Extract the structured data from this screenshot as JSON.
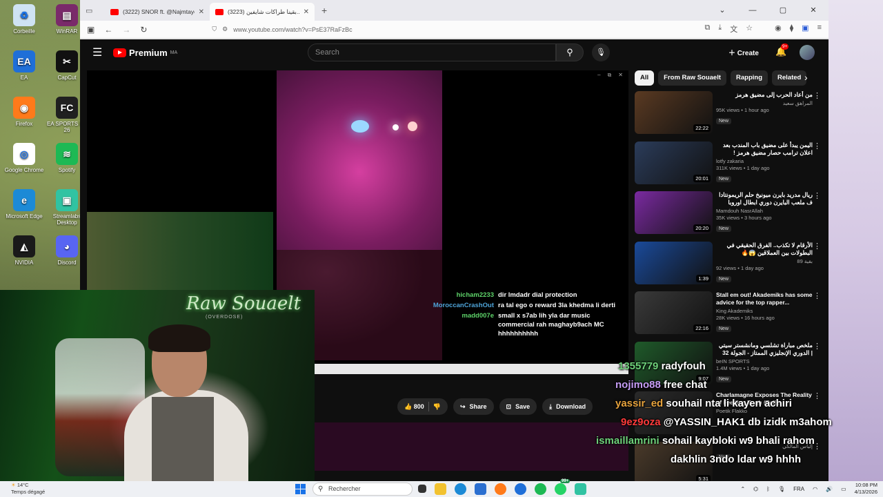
{
  "desktop": {
    "icons": [
      {
        "label": "Corbeille",
        "color": "#cfe3f3",
        "glyph": "♻"
      },
      {
        "label": "WinRAR",
        "color": "#7a2a6a",
        "glyph": "▤"
      },
      {
        "label": "EA",
        "color": "#1f6fd8",
        "glyph": "EA"
      },
      {
        "label": "CapCut",
        "color": "#111111",
        "glyph": "✂"
      },
      {
        "label": "Firefox",
        "color": "#ff7a1a",
        "glyph": "◉"
      },
      {
        "label": "EA SPORTS FC 26",
        "color": "#202020",
        "glyph": "FC"
      },
      {
        "label": "Google Chrome",
        "color": "#ffffff",
        "glyph": "◎"
      },
      {
        "label": "Spotify",
        "color": "#1db954",
        "glyph": "≋"
      },
      {
        "label": "Microsoft Edge",
        "color": "#1c8ad6",
        "glyph": "e"
      },
      {
        "label": "Streamlabs Desktop",
        "color": "#31c3a2",
        "glyph": "▣"
      },
      {
        "label": "NVIDIA",
        "color": "#1a1a1a",
        "glyph": "◭"
      },
      {
        "label": "Discord",
        "color": "#5865f2",
        "glyph": "◕"
      }
    ]
  },
  "browser": {
    "tabs": [
      {
        "title": "(3222) SNOR ft. @Najmtayer - I",
        "active": false
      },
      {
        "title": "(3223) بقينا طراكات شايفين...",
        "active": true
      }
    ],
    "url": "www.youtube.com/watch?v=PsE37RaFzBc"
  },
  "youtube": {
    "logo_text": "Premium",
    "region": "MA",
    "search_placeholder": "Search",
    "create_label": "Create",
    "notif_count": "9+",
    "actions": {
      "likes": "800",
      "share": "Share",
      "save": "Save",
      "download": "Download"
    },
    "chips": [
      "All",
      "From Raw Souaelt",
      "Rapping",
      "Related"
    ],
    "recommendations": [
      {
        "title": "من أعاد الحرب إلى مضيق هرمز",
        "channel": "المراهق سعيد",
        "meta": "95K views • 1 hour ago",
        "duration": "22:22",
        "new": "New",
        "thumb": "#5a3a22"
      },
      {
        "title": "اليمن يبدأ على مضيق باب المندب بعد اعلان ترامب حصار مضيق هرمز !",
        "channel": "lotfy zakaria",
        "meta": "311K views • 1 day ago",
        "duration": "20:01",
        "new": "New",
        "thumb": "#2b3c5a"
      },
      {
        "title": "ريال مدريد بايرن ميونيخ حلم الريمونتادا ف ملعب البايرن دوري ابطال اوروبا ارسنال",
        "channel": "Mamdouh NasrAllah",
        "meta": "35K views • 3 hours ago",
        "duration": "20:20",
        "new": "New",
        "thumb": "#7a2aa0"
      },
      {
        "title": "الأرقام لا تكذب.. الفرق الحقيقي في البطولات بين العملاقين 😱🔥",
        "channel": "بقية 89",
        "meta": "92 views • 1 day ago",
        "duration": "1:39",
        "new": "New",
        "thumb": "#1a4a9a"
      },
      {
        "title": "Stall em out! Akademiks has some advice for the top rapper...",
        "channel": "King Akademiks",
        "meta": "28K views • 16 hours ago",
        "duration": "22:16",
        "new": "New",
        "thumb": "#3a3a3a"
      },
      {
        "title": "ملخص مباراة تشلسي ومانشستر سيتي | الدوري الإنجليزي الممتاز - الجولة 32",
        "channel": "beIN SPORTS",
        "meta": "1.4M views • 1 day ago",
        "duration": "9:07",
        "new": "New",
        "thumb": "#1f5a2a"
      },
      {
        "title": "Charlamagne Exposes The Reality of Feeding Truth (Full...",
        "channel": "Poetik Flakko",
        "meta": "",
        "duration": "",
        "new": "",
        "thumb": "#2a2a2a"
      },
      {
        "title": "",
        "channel": "إلياس المالكي",
        "meta": "",
        "duration": "5:31",
        "new": "New",
        "thumb": "#4a3a2a"
      }
    ]
  },
  "video_chat": [
    {
      "user": "hicham2233",
      "msg": "dir lmdadr dial protection",
      "color": "green"
    },
    {
      "user": "MoroccanCrashOut",
      "msg": "ra tal ego o reward 3la khedma li derti",
      "color": "blue"
    },
    {
      "user": "madd007e",
      "msg": "small x s7ab lih yla dar music commercial rah maghayb9ach MC hhhhhhhhhh",
      "color": "green"
    }
  ],
  "overlay_chat": [
    {
      "user": "1355779",
      "msg": "radyfouh",
      "ucolor": "#6ed17a"
    },
    {
      "user": "nojimo88",
      "msg": "free chat",
      "ucolor": "#c59cf5"
    },
    {
      "user": "yassir_ed",
      "msg": "souhail nta li kayen achiri",
      "ucolor": "#e6a23c"
    },
    {
      "user": "9ez9oza",
      "msg": "@YASSIN_HAK1 db izidk m3ahom",
      "ucolor": "#ff3a3a"
    },
    {
      "user": "ismaillamrini",
      "msg": "sohail kaybloki w9 bhali rahom",
      "ucolor": "#6ed17a"
    },
    {
      "user": "",
      "msg": "dakhlin 3ndo ldar w9 hhhh",
      "ucolor": "#6ed17a"
    }
  ],
  "streamer": {
    "neon_text": "Raw Souaelt",
    "neon_sub": "(OVERDOSE)"
  },
  "taskbar": {
    "weather_temp": "14°C",
    "weather_desc": "Temps dégagé",
    "search_label": "Rechercher",
    "language": "FRA",
    "time": "10:08 PM",
    "date": "4/13/2026",
    "badge": "99+"
  }
}
